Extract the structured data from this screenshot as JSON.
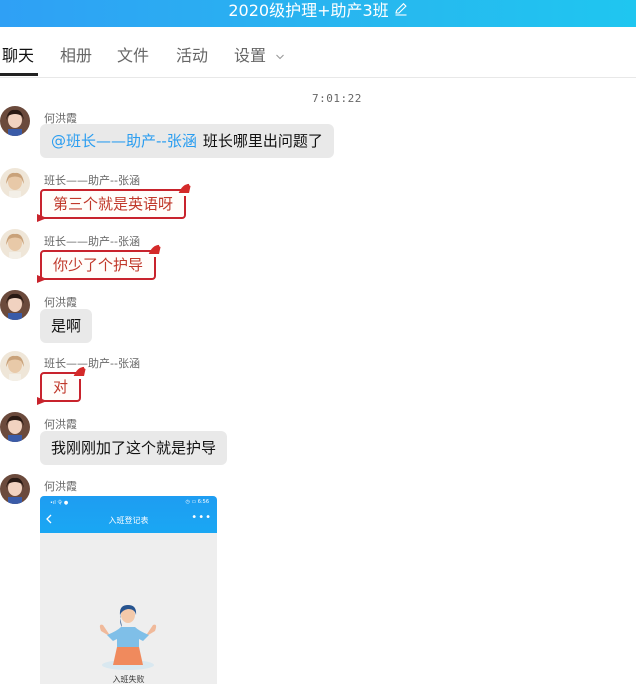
{
  "titlebar": {
    "title": "2020级护理+助产3班"
  },
  "tabs": [
    "聊天",
    "相册",
    "文件",
    "活动",
    "设置"
  ],
  "time": "7:01:22",
  "messages": [
    {
      "sender": "何洪霞",
      "mention": "@班长——助产--张涵",
      "text": "班长哪里出问题了",
      "style": "plain"
    },
    {
      "sender": "班长——助产--张涵",
      "text": "第三个就是英语呀",
      "style": "festive"
    },
    {
      "sender": "班长——助产--张涵",
      "text": "你少了个护导",
      "style": "festive"
    },
    {
      "sender": "何洪霞",
      "text": "是啊",
      "style": "plain"
    },
    {
      "sender": "班长——助产--张涵",
      "text": "对",
      "style": "festive"
    },
    {
      "sender": "何洪霞",
      "text": "我刚刚加了这个就是护导",
      "style": "plain"
    },
    {
      "sender": "何洪霞",
      "style": "image"
    }
  ],
  "screenshot": {
    "title": "入班登记表",
    "status_left": "•ıl 令 ●",
    "status_right": "◷ ▭ 6:56",
    "more": "•••",
    "caption": "入班失败"
  },
  "colors": {
    "accent": "#2a9df0",
    "festive_red": "#c8232c"
  }
}
